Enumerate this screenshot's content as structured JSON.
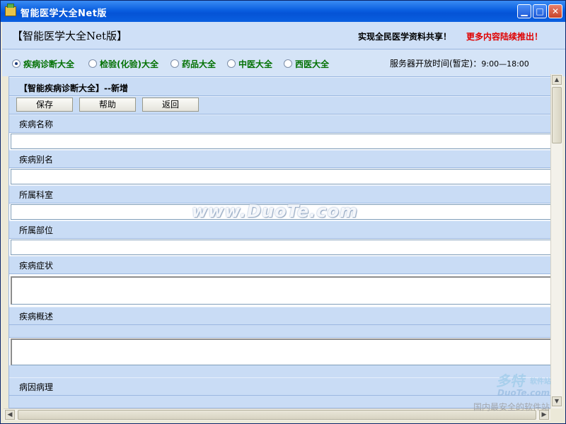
{
  "window": {
    "title": "智能医学大全Net版"
  },
  "header": {
    "brand": "【智能医学大全Net版】",
    "slogan": "实现全民医学资料共享！",
    "slogan_highlight": "更多内容陆续推出！"
  },
  "nav": {
    "options": [
      {
        "label": "疾病诊断大全",
        "selected": true
      },
      {
        "label": "检验(化验)大全",
        "selected": false
      },
      {
        "label": "药品大全",
        "selected": false
      },
      {
        "label": "中医大全",
        "selected": false
      },
      {
        "label": "西医大全",
        "selected": false
      }
    ],
    "server_label": "服务器开放时间(暂定)：",
    "server_hours": "9:00—18:00"
  },
  "form": {
    "section_title": "【智能疾病诊断大全】--新增",
    "buttons": {
      "save": "保存",
      "help": "帮助",
      "back": "返回"
    },
    "fields": [
      {
        "label": "疾病名称",
        "value": ""
      },
      {
        "label": "疾病别名",
        "value": ""
      },
      {
        "label": "所属科室",
        "value": ""
      },
      {
        "label": "所属部位",
        "value": ""
      },
      {
        "label": "疾病症状",
        "value": ""
      },
      {
        "label": "疾病概述",
        "value": ""
      },
      {
        "label": "病因病理",
        "value": ""
      }
    ]
  },
  "watermark": {
    "text": "www.DuoTe.com",
    "corner_line1": "多特",
    "corner_line2": "软件站",
    "corner_line3": "DuoTe.com",
    "corner_line4": "国内最安全的软件站"
  },
  "colors": {
    "titlebar": "#0a5fe0",
    "header_bg": "#cfe0f7",
    "strip_bg": "#c9dcf5",
    "nav_text": "#007000",
    "highlight_red": "#e00000"
  }
}
